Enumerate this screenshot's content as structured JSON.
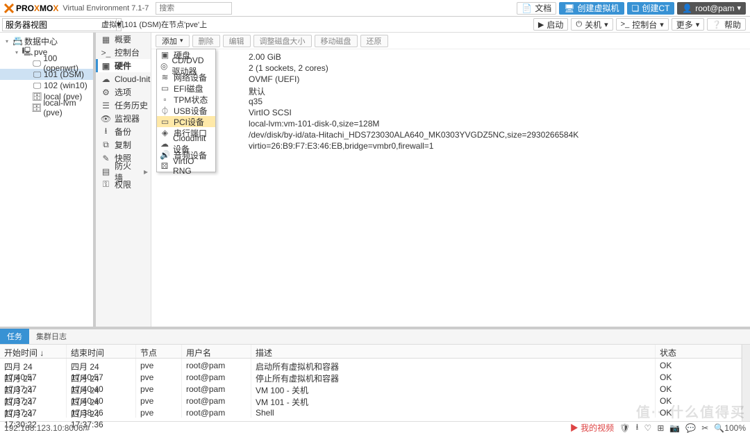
{
  "header": {
    "brand_prefix": "PRO",
    "brand_mid": "X",
    "brand_suffix": "MO",
    "brand_x2": "X",
    "product": "Virtual Environment 7.1-7",
    "search_placeholder": "搜索",
    "docs": "文档",
    "create_vm": "创建虚拟机",
    "create_ct": "创建CT",
    "user": "root@pam"
  },
  "row2": {
    "view_label": "服务器视图",
    "crumb": "虚拟机101 (DSM)在节点'pve'上",
    "start": "启动",
    "shutdown": "关机",
    "console": "控制台",
    "more": "更多",
    "help": "帮助"
  },
  "tree": [
    {
      "label": "数据中心",
      "indent": 0,
      "icon": "server"
    },
    {
      "label": "pve",
      "indent": 1,
      "icon": "node"
    },
    {
      "label": "100 (openwrt)",
      "indent": 2,
      "icon": "vm"
    },
    {
      "label": "101 (DSM)",
      "indent": 2,
      "icon": "vm",
      "sel": true
    },
    {
      "label": "102 (win10)",
      "indent": 2,
      "icon": "vm"
    },
    {
      "label": "local (pve)",
      "indent": 2,
      "icon": "storage"
    },
    {
      "label": "local-lvm (pve)",
      "indent": 2,
      "icon": "storage"
    }
  ],
  "sidemenu": [
    {
      "label": "概要",
      "icon": "▦"
    },
    {
      "label": "控制台",
      "icon": ">_"
    },
    {
      "label": "硬件",
      "icon": "▣",
      "active": true
    },
    {
      "label": "Cloud-Init",
      "icon": "☁"
    },
    {
      "label": "选项",
      "icon": "⚙"
    },
    {
      "label": "任务历史",
      "icon": "☰"
    },
    {
      "label": "监视器",
      "icon": "👁"
    },
    {
      "label": "备份",
      "icon": "⭳"
    },
    {
      "label": "复制",
      "icon": "⧉"
    },
    {
      "label": "快照",
      "icon": "✎"
    },
    {
      "label": "防火墙",
      "icon": "▤",
      "exp": true
    },
    {
      "label": "权限",
      "icon": "⚿"
    }
  ],
  "toolbar": {
    "add": "添加",
    "remove": "删除",
    "edit": "编辑",
    "resize": "调整磁盘大小",
    "move": "移动磁盘",
    "revert": "还原"
  },
  "dropdown": [
    {
      "icon": "▣",
      "label": "硬盘"
    },
    {
      "icon": "◎",
      "label": "CD/DVD驱动器"
    },
    {
      "icon": "≋",
      "label": "网络设备"
    },
    {
      "icon": "▭",
      "label": "EFI磁盘"
    },
    {
      "icon": "▫",
      "label": "TPM状态"
    },
    {
      "icon": "⏀",
      "label": "USB设备"
    },
    {
      "icon": "▭",
      "label": "PCI设备",
      "hl": true
    },
    {
      "icon": "◈",
      "label": "串行端口"
    },
    {
      "icon": "☁",
      "label": "CloudInit设备"
    },
    {
      "icon": "🔊",
      "label": "音频设备"
    },
    {
      "icon": "⚄",
      "label": "VirtIO RNG"
    }
  ],
  "hw_rows": [
    "2.00 GiB",
    "2 (1 sockets, 2 cores)",
    "OVMF (UEFI)",
    "默认",
    "q35",
    "VirtIO SCSI",
    "local-lvm:vm-101-disk-0,size=128M",
    "/dev/disk/by-id/ata-Hitachi_HDS723030ALA640_MK0303YVGDZ5NC,size=2930266584K",
    "virtio=26:B9:F7:E3:46:EB,bridge=vmbr0,firewall=1"
  ],
  "bottom": {
    "tab_tasks": "任务",
    "tab_cluster": "集群日志",
    "col_start": "开始时间 ↓",
    "col_end": "结束时间",
    "col_node": "节点",
    "col_user": "用户名",
    "col_desc": "描述",
    "col_status": "状态",
    "rows": [
      {
        "s": "四月 24 17:40:57",
        "e": "四月 24 17:40:57",
        "n": "pve",
        "u": "root@pam",
        "d": "启动所有虚拟机和容器",
        "st": "OK"
      },
      {
        "s": "四月 24 17:37:37",
        "e": "四月 24 17:40:40",
        "n": "pve",
        "u": "root@pam",
        "d": "停止所有虚拟机和容器",
        "st": "OK"
      },
      {
        "s": "四月 24 17:37:37",
        "e": "四月 24 17:40:40",
        "n": "pve",
        "u": "root@pam",
        "d": "VM 100 - 关机",
        "st": "OK"
      },
      {
        "s": "四月 24 17:37:37",
        "e": "四月 24 17:38:26",
        "n": "pve",
        "u": "root@pam",
        "d": "VM 101 - 关机",
        "st": "OK"
      },
      {
        "s": "四月 24 17:30:22",
        "e": "四月 24 17:37:36",
        "n": "pve",
        "u": "root@pam",
        "d": "Shell",
        "st": "OK"
      }
    ]
  },
  "status": {
    "url": "192.168.123.10:8006/#",
    "video": "我的视频",
    "zoom": "100%"
  },
  "watermark": "值···什么值得买"
}
